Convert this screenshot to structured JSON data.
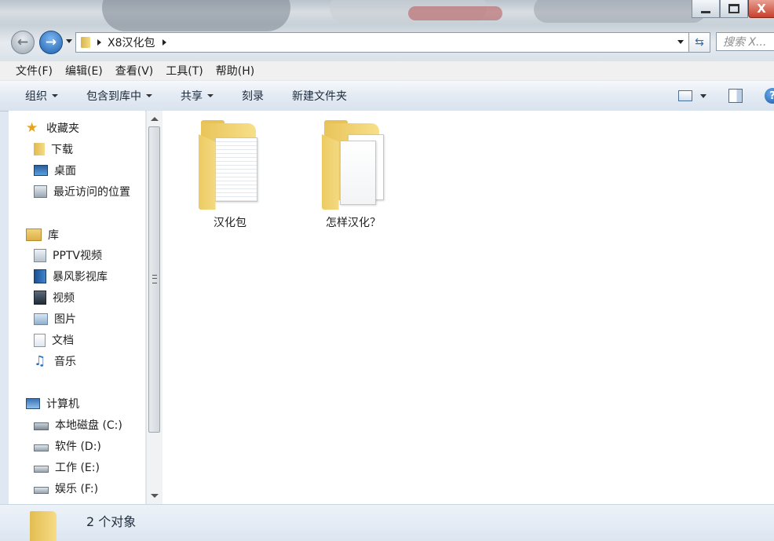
{
  "window": {
    "caption_buttons": [
      "minimize",
      "maximize",
      "close"
    ],
    "close_glyph": "X"
  },
  "address": {
    "crumb": "X8汉化包",
    "search_placeholder": "搜索 X..."
  },
  "menu": {
    "file": "文件(F)",
    "edit": "编辑(E)",
    "view": "查看(V)",
    "tools": "工具(T)",
    "help": "帮助(H)"
  },
  "toolbar": {
    "organize": "组织",
    "include_library": "包含到库中",
    "share": "共享",
    "burn": "刻录",
    "new_folder": "新建文件夹"
  },
  "sidebar": {
    "favorites": {
      "label": "收藏夹",
      "items": [
        "下载",
        "桌面",
        "最近访问的位置"
      ]
    },
    "libraries": {
      "label": "库",
      "items": [
        "PPTV视频",
        "暴风影视库",
        "视频",
        "图片",
        "文档",
        "音乐"
      ]
    },
    "computer": {
      "label": "计算机",
      "items": [
        "本地磁盘 (C:)",
        "软件 (D:)",
        "工作 (E:)",
        "娱乐 (F:)"
      ]
    }
  },
  "files": [
    {
      "name": "汉化包",
      "icon": "folder-with-documents-icon"
    },
    {
      "name": "怎样汉化？",
      "icon": "folder-with-documents-icon"
    }
  ],
  "status": {
    "count_text": "2 个对象"
  },
  "colors": {
    "toolbar_gradient_top": "#f6f9fc",
    "toolbar_gradient_bottom": "#d9e3ee",
    "folder_yellow": "#f4d97f",
    "forward_button_blue": "#1f5fae",
    "close_button_red": "#c7402d"
  }
}
